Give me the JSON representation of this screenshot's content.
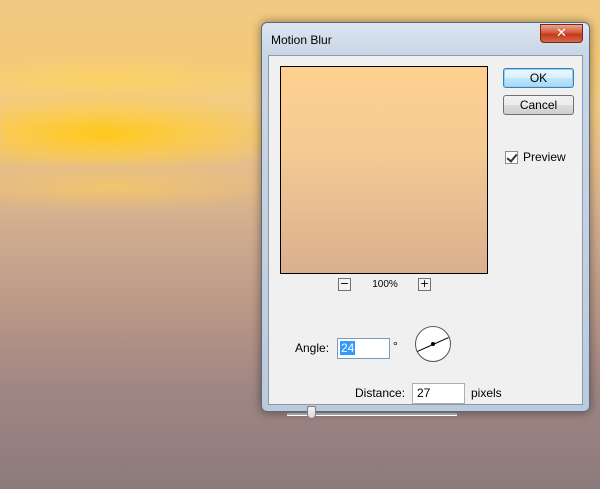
{
  "dialog": {
    "title": "Motion Blur",
    "close_glyph": "✕",
    "buttons": {
      "ok": "OK",
      "cancel": "Cancel"
    },
    "preview": {
      "label": "Preview",
      "checked": true
    },
    "zoom": {
      "minus": "−",
      "level": "100%",
      "plus": "+"
    },
    "angle": {
      "label": "Angle:",
      "value": "24",
      "unit": "°"
    },
    "distance": {
      "label": "Distance:",
      "value": "27",
      "unit": "pixels",
      "slider_fraction": 0.1
    }
  },
  "icons": [
    "close-icon",
    "checkbox-check-icon",
    "zoom-out-icon",
    "zoom-in-icon",
    "angle-dial-icon"
  ],
  "colors": {
    "ok_border": "#3c7fb1",
    "close_red": "#c13a1c",
    "selection": "#3399ff"
  }
}
